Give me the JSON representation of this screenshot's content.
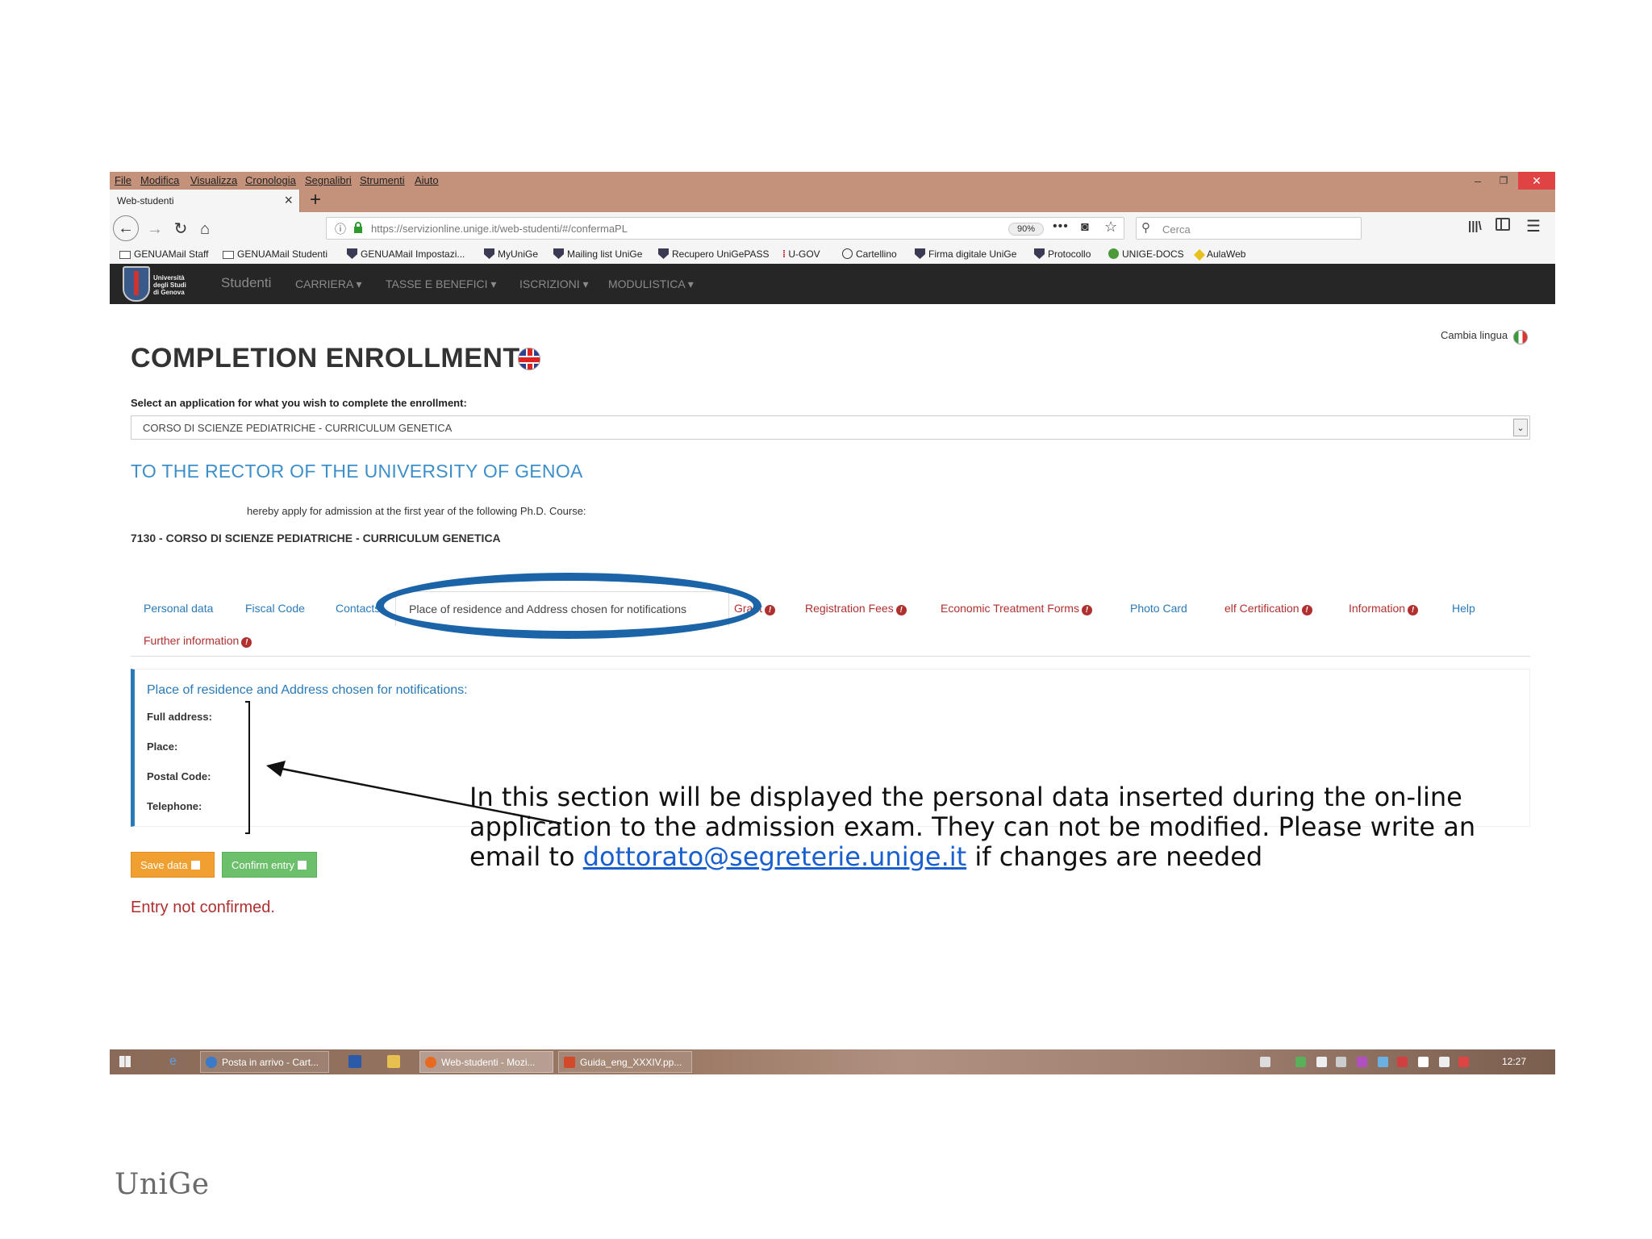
{
  "browser": {
    "menu": [
      "File",
      "Modifica",
      "Visualizza",
      "Cronologia",
      "Segnalibri",
      "Strumenti",
      "Aiuto"
    ],
    "tab_title": "Web-studenti",
    "url": "https://servizionline.unige.it/web-studenti/#/confermaPL",
    "zoom": "90%",
    "search_placeholder": "Cerca",
    "bookmarks": [
      "GENUAMail Staff",
      "GENUAMail Studenti",
      "GENUAMail Impostazi...",
      "MyUniGe",
      "Mailing list UniGe",
      "Recupero UniGePASS",
      "U-GOV",
      "Cartellino",
      "Firma digitale UniGe",
      "Protocollo",
      "UNIGE-DOCS",
      "AulaWeb"
    ]
  },
  "site": {
    "logo_text": [
      "Università",
      "degli Studi",
      "di Genova"
    ],
    "nav": [
      "Studenti",
      "CARRIERA ▾",
      "TASSE E BENEFICI ▾",
      "ISCRIZIONI ▾",
      "MODULISTICA ▾"
    ]
  },
  "page": {
    "language_switch": "Cambia lingua",
    "title": "COMPLETION ENROLLMENT",
    "select_label": "Select an application for what you wish to complete the enrollment:",
    "select_value": "CORSO DI SCIENZE PEDIATRICHE - CURRICULUM GENETICA",
    "rector_heading": "TO THE RECTOR OF THE UNIVERSITY OF GENOA",
    "apply_text": "hereby apply for admission at the first year of the following Ph.D. Course:",
    "course": "7130 - CORSO DI SCIENZE PEDIATRICHE - CURRICULUM GENETICA",
    "tabs": {
      "personal_data": "Personal data",
      "fiscal_code": "Fiscal Code",
      "contacts": "Contacts",
      "place_of_residence": "Place of residence and Address chosen for notifications",
      "grant": "Grant",
      "registration_fees": "Registration Fees",
      "economic_treatment": "Economic Treatment Forms",
      "photo_card": "Photo Card",
      "self_certification": "elf Certification",
      "information": "Information",
      "help": "Help",
      "further_information": "Further information"
    },
    "panel": {
      "heading": "Place of residence and Address chosen for notifications:",
      "full_address": "Full address:",
      "place": "Place:",
      "postal_code": "Postal Code:",
      "telephone": "Telephone:"
    },
    "save_button": "Save data",
    "confirm_button": "Confirm entry",
    "status": "Entry not confirmed."
  },
  "taskbar": {
    "items": [
      "Posta in arrivo - Cart...",
      "Web-studenti - Mozi...",
      "Guida_eng_XXXIV.pp..."
    ],
    "clock": "12:27"
  },
  "annotation": {
    "text_before": "In this section will be displayed the personal data inserted during the on-line application to the admission exam. They can not be modified. Please write an email to ",
    "email": "dottorato@segreterie.unige.it",
    "text_after": " if changes are needed"
  },
  "footer_logo": "UniGe",
  "colors": {
    "browser_chrome": "#c4927a",
    "site_header": "#262626",
    "link_blue": "#2a7ab8",
    "warning_red": "#b03030",
    "save_orange": "#f0a030",
    "confirm_green": "#6cc06c",
    "highlight_ellipse": "#1c64a8"
  }
}
